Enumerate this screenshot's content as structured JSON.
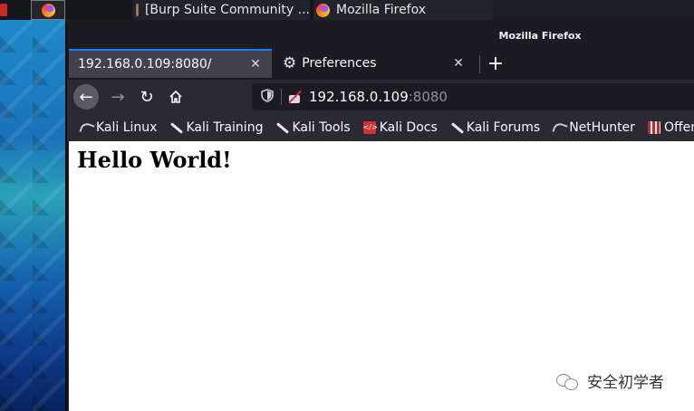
{
  "taskbar": {
    "apps": [
      {
        "label": "[Burp Suite Community ...",
        "icon": "burp-icon"
      },
      {
        "label": "Mozilla Firefox",
        "icon": "firefox-icon"
      }
    ]
  },
  "window": {
    "title": "Mozilla Firefox"
  },
  "tabs": [
    {
      "label": "192.168.0.109:8080/",
      "active": true
    },
    {
      "label": "Preferences",
      "active": false,
      "icon": "gear-icon"
    }
  ],
  "urlbar": {
    "host": "192.168.0.109",
    "port": ":8080"
  },
  "bookmarks": [
    {
      "label": "Kali Linux",
      "icon": "kali-icon"
    },
    {
      "label": "Kali Training",
      "icon": "blade-icon"
    },
    {
      "label": "Kali Tools",
      "icon": "blade-icon"
    },
    {
      "label": "Kali Docs",
      "icon": "kali-docs-icon"
    },
    {
      "label": "Kali Forums",
      "icon": "blade-icon"
    },
    {
      "label": "NetHunter",
      "icon": "kali-icon"
    },
    {
      "label": "Offensiv",
      "icon": "offensive-security-icon"
    }
  ],
  "page": {
    "heading": "Hello World!"
  },
  "watermark": {
    "text": "安全初学者"
  },
  "colors": {
    "accent": "#0a84ff",
    "toolbar": "#2b2a33",
    "tab_active": "#42414d"
  }
}
